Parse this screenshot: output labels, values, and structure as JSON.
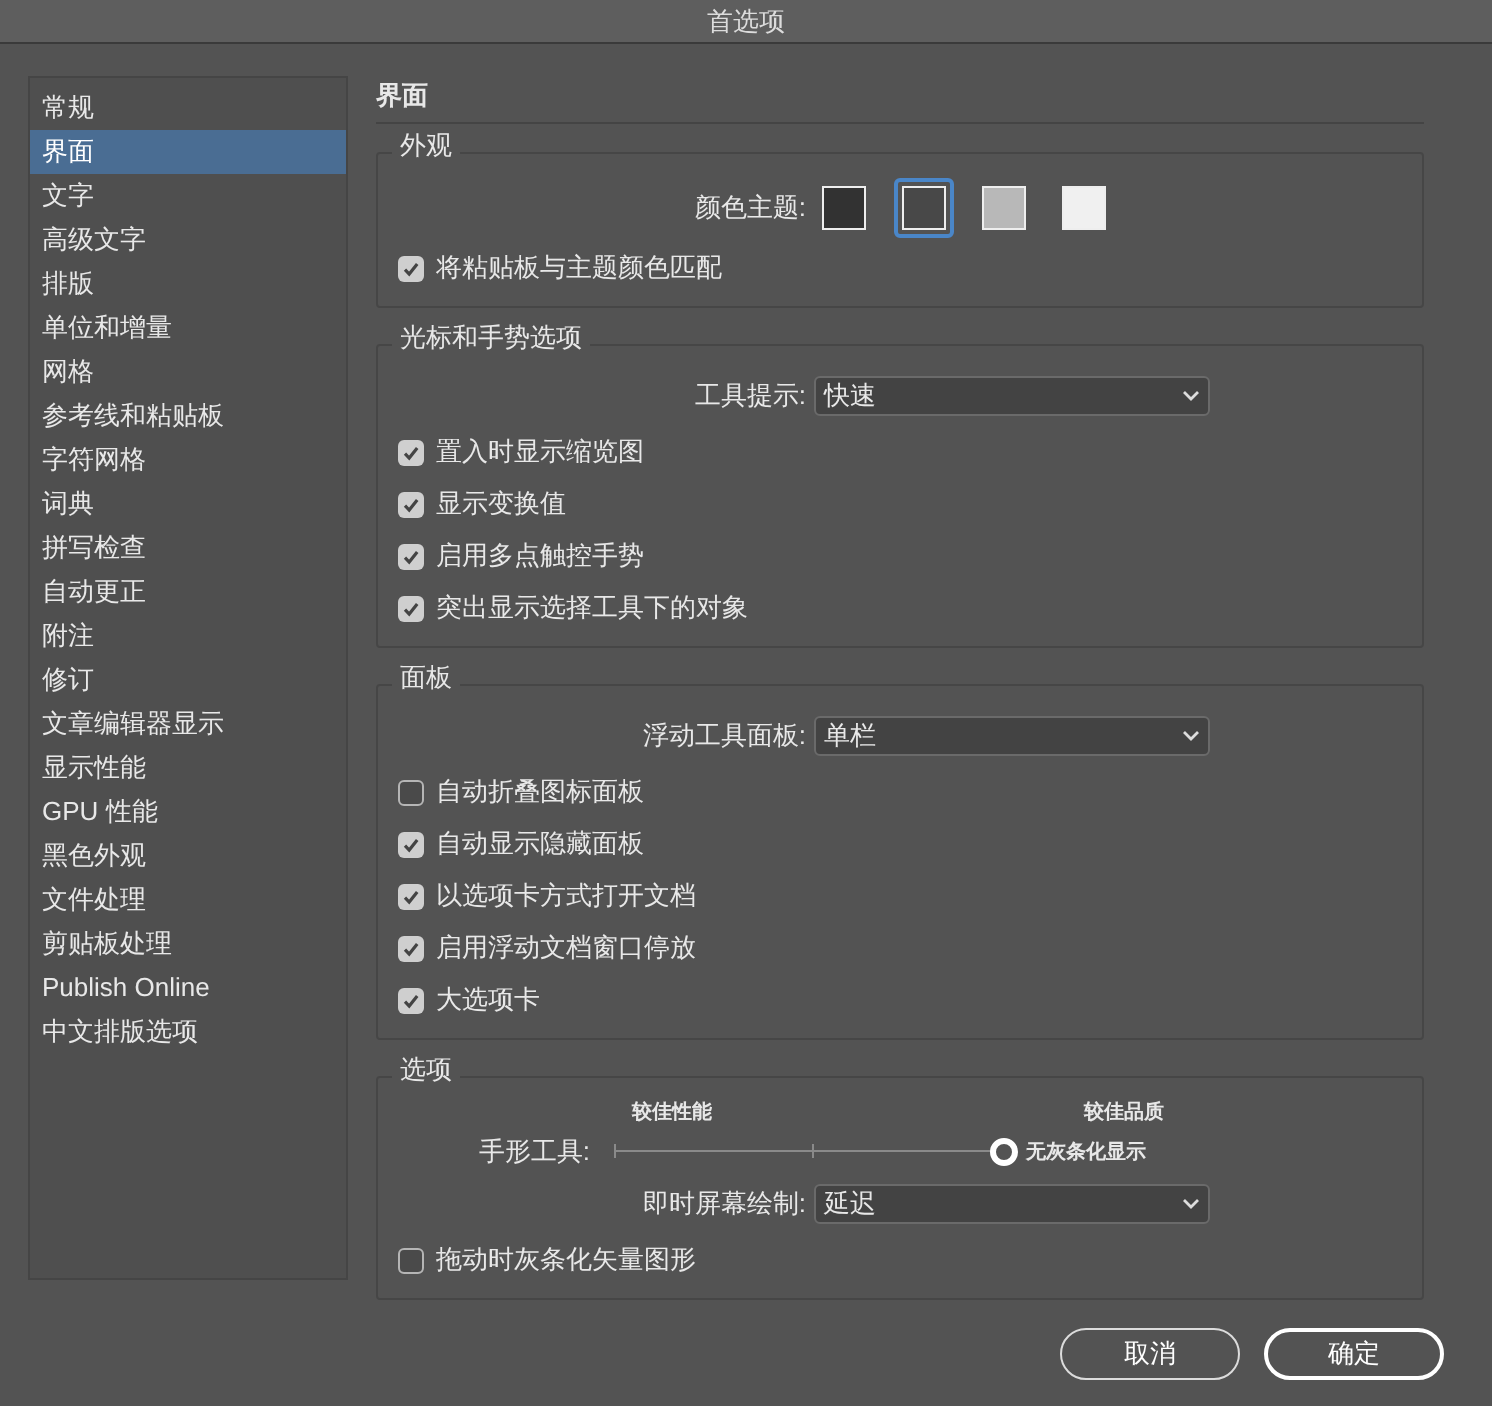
{
  "window": {
    "title": "首选项"
  },
  "sidebar": {
    "items": [
      {
        "label": "常规",
        "selected": false
      },
      {
        "label": "界面",
        "selected": true
      },
      {
        "label": "文字",
        "selected": false
      },
      {
        "label": "高级文字",
        "selected": false
      },
      {
        "label": "排版",
        "selected": false
      },
      {
        "label": "单位和增量",
        "selected": false
      },
      {
        "label": "网格",
        "selected": false
      },
      {
        "label": "参考线和粘贴板",
        "selected": false
      },
      {
        "label": "字符网格",
        "selected": false
      },
      {
        "label": "词典",
        "selected": false
      },
      {
        "label": "拼写检查",
        "selected": false
      },
      {
        "label": "自动更正",
        "selected": false
      },
      {
        "label": "附注",
        "selected": false
      },
      {
        "label": "修订",
        "selected": false
      },
      {
        "label": "文章编辑器显示",
        "selected": false
      },
      {
        "label": "显示性能",
        "selected": false
      },
      {
        "label": "GPU 性能",
        "selected": false
      },
      {
        "label": "黑色外观",
        "selected": false
      },
      {
        "label": "文件处理",
        "selected": false
      },
      {
        "label": "剪贴板处理",
        "selected": false
      },
      {
        "label": "Publish Online",
        "selected": false
      },
      {
        "label": "中文排版选项",
        "selected": false
      }
    ]
  },
  "page_title": "界面",
  "groups": [
    {
      "title": "外观",
      "rows": [
        {
          "kind": "swatches",
          "label": "颜色主题:",
          "swatches": [
            {
              "color": "#323232",
              "selected": false
            },
            {
              "color": "#484848",
              "selected": true
            },
            {
              "color": "#b8b8b8",
              "selected": false
            },
            {
              "color": "#f0f0f0",
              "selected": false
            }
          ]
        },
        {
          "kind": "checkbox",
          "label": "将粘贴板与主题颜色匹配",
          "checked": true
        }
      ]
    },
    {
      "title": "光标和手势选项",
      "rows": [
        {
          "kind": "dropdown",
          "label": "工具提示:",
          "value": "快速"
        },
        {
          "kind": "checkbox",
          "label": "置入时显示缩览图",
          "checked": true
        },
        {
          "kind": "checkbox",
          "label": "显示变换值",
          "checked": true
        },
        {
          "kind": "checkbox",
          "label": "启用多点触控手势",
          "checked": true
        },
        {
          "kind": "checkbox",
          "label": "突出显示选择工具下的对象",
          "checked": true
        }
      ]
    },
    {
      "title": "面板",
      "rows": [
        {
          "kind": "dropdown",
          "label": "浮动工具面板:",
          "value": "单栏"
        },
        {
          "kind": "checkbox",
          "label": "自动折叠图标面板",
          "checked": false
        },
        {
          "kind": "checkbox",
          "label": "自动显示隐藏面板",
          "checked": true
        },
        {
          "kind": "checkbox",
          "label": "以选项卡方式打开文档",
          "checked": true
        },
        {
          "kind": "checkbox",
          "label": "启用浮动文档窗口停放",
          "checked": true
        },
        {
          "kind": "checkbox",
          "label": "大选项卡",
          "checked": true
        }
      ]
    },
    {
      "title": "选项",
      "rows": [
        {
          "kind": "slider",
          "label": "手形工具:",
          "left_caption": "较佳性能",
          "right_caption": "较佳品质",
          "reading": "无灰条化显示",
          "level": 1
        },
        {
          "kind": "dropdown",
          "label": "即时屏幕绘制:",
          "value": "延迟"
        },
        {
          "kind": "checkbox",
          "label": "拖动时灰条化矢量图形",
          "checked": false
        }
      ]
    }
  ],
  "buttons": [
    {
      "label": "取消",
      "kind": "secondary"
    },
    {
      "label": "确定",
      "kind": "primary"
    }
  ]
}
